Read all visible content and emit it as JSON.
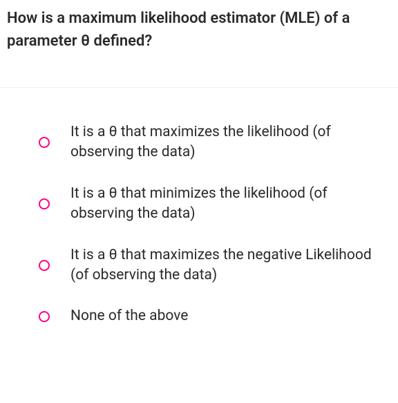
{
  "question": {
    "text": "How is a maximum likelihood estimator (MLE) of a parameter θ defined?"
  },
  "options": [
    {
      "label": "It is a θ that maximizes the likelihood (of observing the data)"
    },
    {
      "label": "It is a θ that minimizes the likelihood (of observing the data)"
    },
    {
      "label": "It is a θ that maximizes the negative Likelihood (of observing the data)"
    },
    {
      "label": "None of the above"
    }
  ]
}
